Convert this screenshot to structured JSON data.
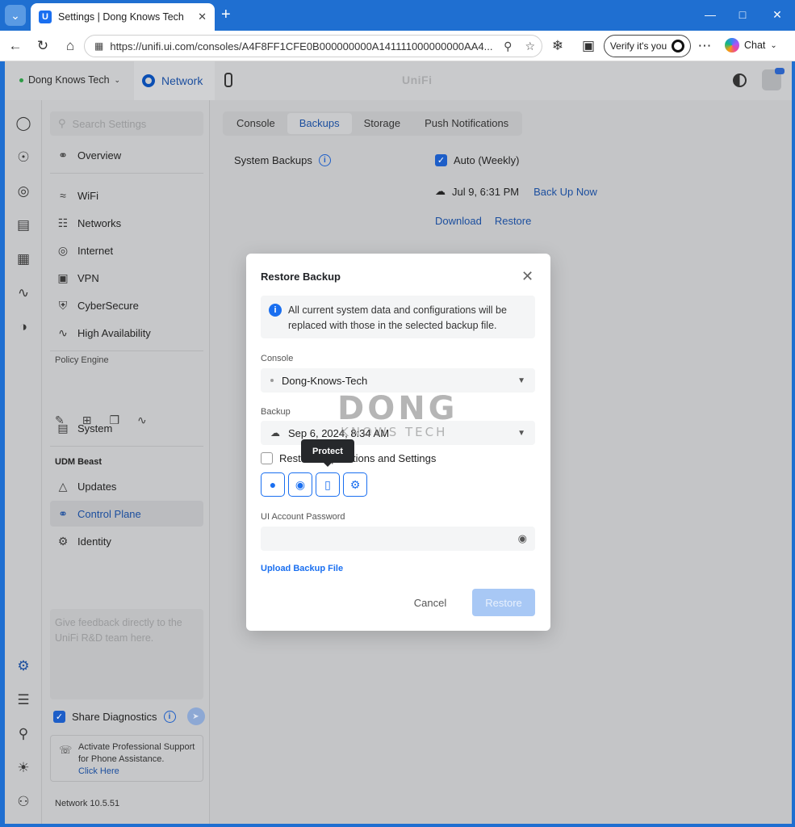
{
  "browser": {
    "tab_title": "Settings | Dong Knows Tech",
    "url": "https://unifi.ui.com/consoles/A4F8FF1CFE0B000000000A141111000000000AA4...",
    "verify_label": "Verify it's you",
    "chat_label": "Chat"
  },
  "header": {
    "site": "Dong Knows Tech",
    "app": "Network",
    "logo": "UniFi"
  },
  "sidebar": {
    "search_placeholder": "Search Settings",
    "items": {
      "overview": "Overview",
      "wifi": "WiFi",
      "networks": "Networks",
      "internet": "Internet",
      "vpn": "VPN",
      "cybersecure": "CyberSecure",
      "ha": "High Availability",
      "system": "System",
      "updates": "Updates",
      "control_plane": "Control Plane",
      "identity": "Identity"
    },
    "policy_engine_label": "Policy Engine",
    "device_section_label": "UDM Beast",
    "feedback_placeholder": "Give feedback directly to the UniFi R&D team here.",
    "share_diagnostics": "Share Diagnostics",
    "support_text": "Activate Professional Support for Phone Assistance.",
    "support_link": "Click Here",
    "version": "Network 10.5.51"
  },
  "main": {
    "tabs": [
      "Console",
      "Backups",
      "Storage",
      "Push Notifications"
    ],
    "active_tab": "Backups",
    "system_backups_label": "System Backups",
    "auto_label": "Auto (Weekly)",
    "last_backup": "Jul 9, 6:31 PM",
    "back_up_now": "Back Up Now",
    "download": "Download",
    "restore": "Restore"
  },
  "modal": {
    "title": "Restore Backup",
    "note": "All current system data and configurations will be replaced with those in the selected backup file.",
    "console_label": "Console",
    "console_value": "Dong-Knows-Tech",
    "backup_label": "Backup",
    "backup_value": "Sep 6, 2024, 8:34 AM",
    "restore_apps_label": "Restore Applications and Settings",
    "tooltip": "Protect",
    "password_label": "UI Account Password",
    "upload_label": "Upload Backup File",
    "cancel_label": "Cancel",
    "restore_label": "Restore"
  },
  "watermark": {
    "line1": "DONG",
    "line2": "KNOWS TECH"
  },
  "colors": {
    "accent": "#1a6ff0",
    "browser_frame": "#1f6fd1",
    "overlay": "#c4c5c7"
  }
}
